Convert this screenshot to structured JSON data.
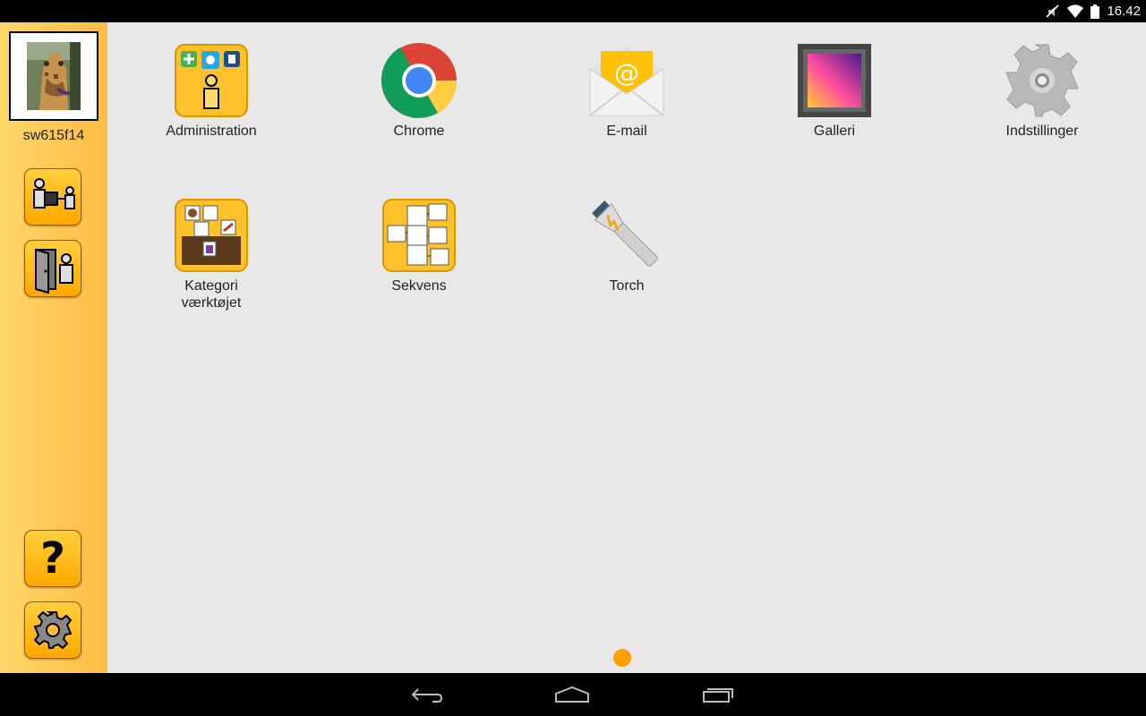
{
  "status": {
    "time": "16.42"
  },
  "sidebar": {
    "username": "sw615f14"
  },
  "apps": [
    {
      "label": "Administration",
      "icon": "administration-icon"
    },
    {
      "label": "Chrome",
      "icon": "chrome-icon"
    },
    {
      "label": "E-mail",
      "icon": "email-icon"
    },
    {
      "label": "Galleri",
      "icon": "gallery-icon"
    },
    {
      "label": "Indstillinger",
      "icon": "settings-icon"
    },
    {
      "label": "Kategori\nværktøjet",
      "icon": "category-tool-icon"
    },
    {
      "label": "Sekvens",
      "icon": "sequence-icon"
    },
    {
      "label": "Torch",
      "icon": "torch-icon"
    }
  ],
  "help": {
    "label": "?"
  },
  "pager": {
    "current_page": 1,
    "total_pages": 1
  },
  "colors": {
    "sidebar": "#ffc94f",
    "accent": "#ffa000",
    "background": "#e8e8e8"
  }
}
